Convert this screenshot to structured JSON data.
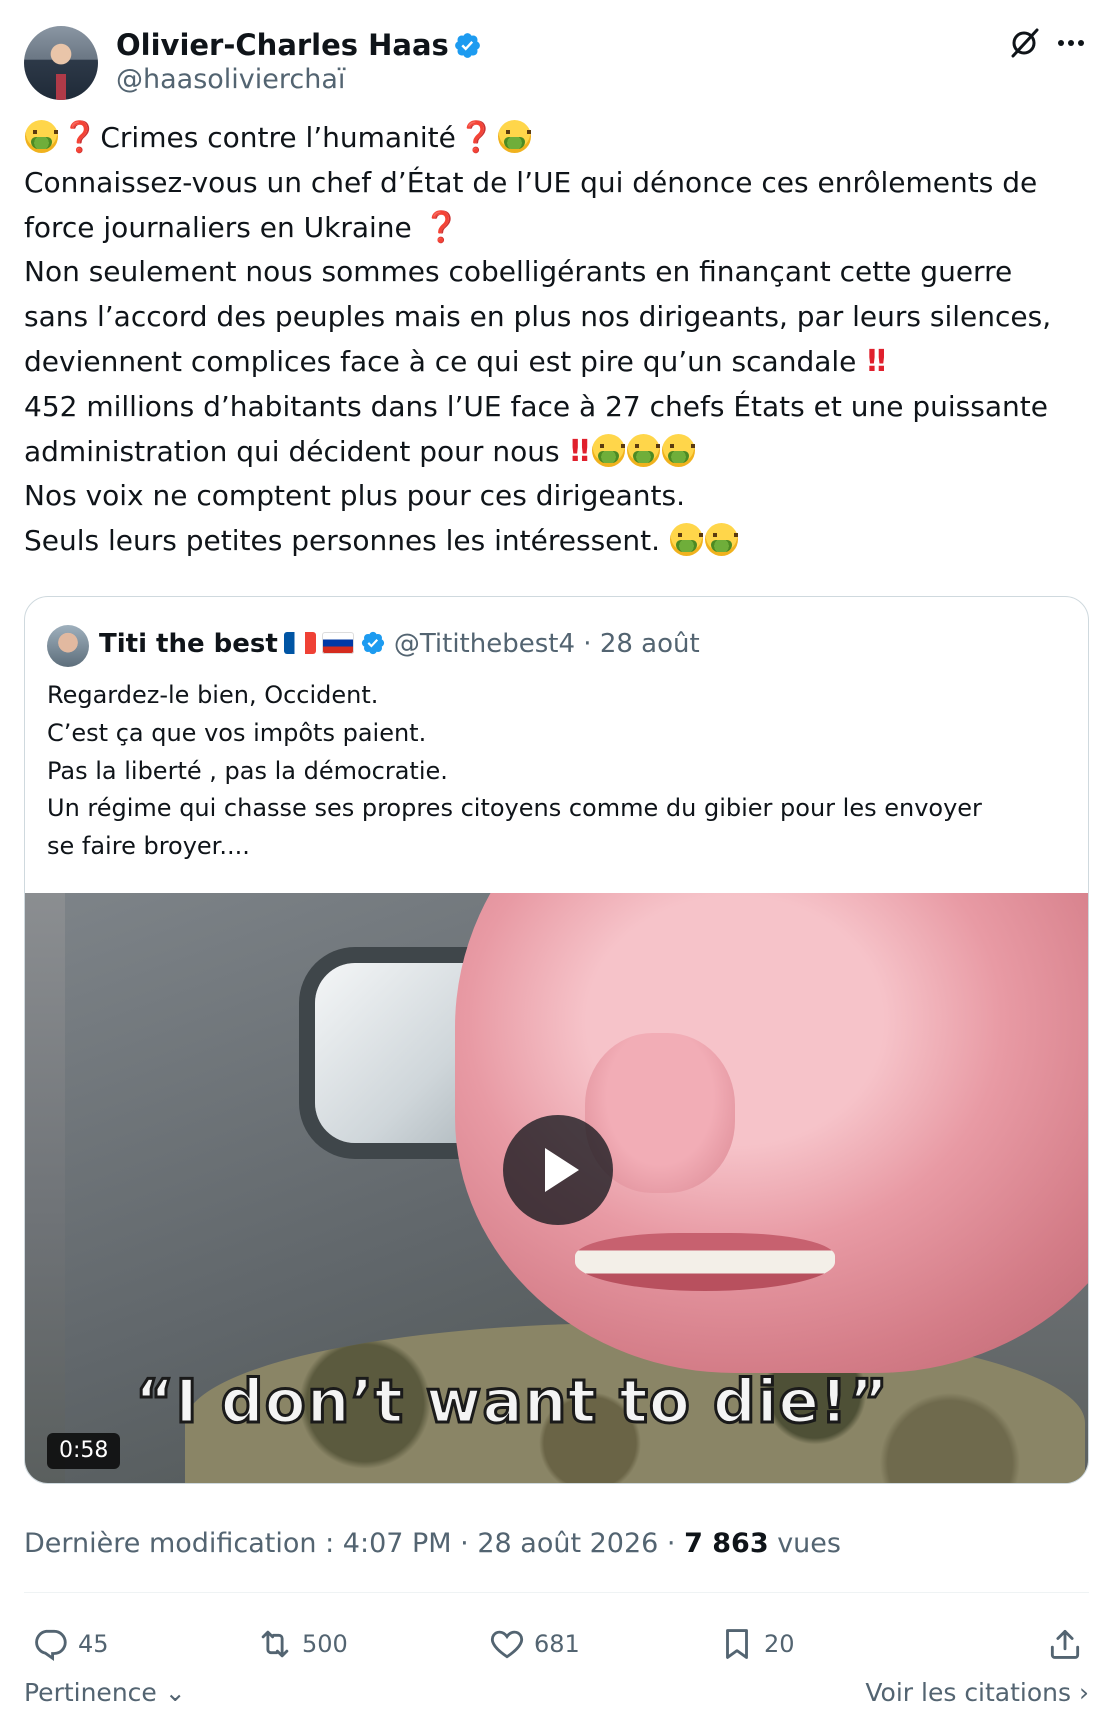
{
  "author": {
    "name": "Olivier-Charles Haas",
    "handle": "@haasolivierchaï",
    "verified": true,
    "verified_color": "#1d9bf0"
  },
  "post": {
    "lines": [
      "Crimes contre l’humanité",
      "Connaissez-vous un chef d’État de l’UE qui dénonce ces enrôlements de",
      "force journaliers en Ukraine",
      "Non seulement nous sommes cobelligérants en finançant cette guerre",
      "sans l’accord des peuples mais en plus nos dirigeants, par leurs silences,",
      "deviennent complices face à ce qui est pire qu’un scandale",
      "452 millions d’habitants dans l’UE face à 27 chefs États et une puissante",
      "administration qui décident pour nous",
      "Nos voix ne comptent plus pour ces dirigeants.",
      "Seuls leurs petites personnes les intéressent."
    ],
    "emojis": {
      "face": "face-vomiting-emoji",
      "question": "❓",
      "double_exclamation": "‼"
    }
  },
  "quote": {
    "name": "Titi the best",
    "flags": [
      "🇫🇷",
      "🇷🇺"
    ],
    "handle": "@Titithebest4",
    "separator": "·",
    "date": "28 août",
    "lines": [
      "Regardez-le bien, Occident.",
      "C’est ça que vos impôts paient.",
      "Pas la liberté , pas la démocratie.",
      "Un régime qui chasse ses propres citoyens comme du gibier pour les envoyer",
      "se faire broyer...."
    ],
    "video": {
      "caption": "“I don’t want to die!”",
      "duration": "0:58"
    }
  },
  "meta": {
    "edited_label": "Dernière modification : 4:07 PM · 28 août 2026 · ",
    "views_count": "7 863",
    "views_label": " vues"
  },
  "actions": {
    "replies": "45",
    "reposts": "500",
    "likes": "681",
    "bookmarks": "20"
  },
  "footer": {
    "sort_label": "Pertinence",
    "quotes_label": "Voir les citations"
  }
}
